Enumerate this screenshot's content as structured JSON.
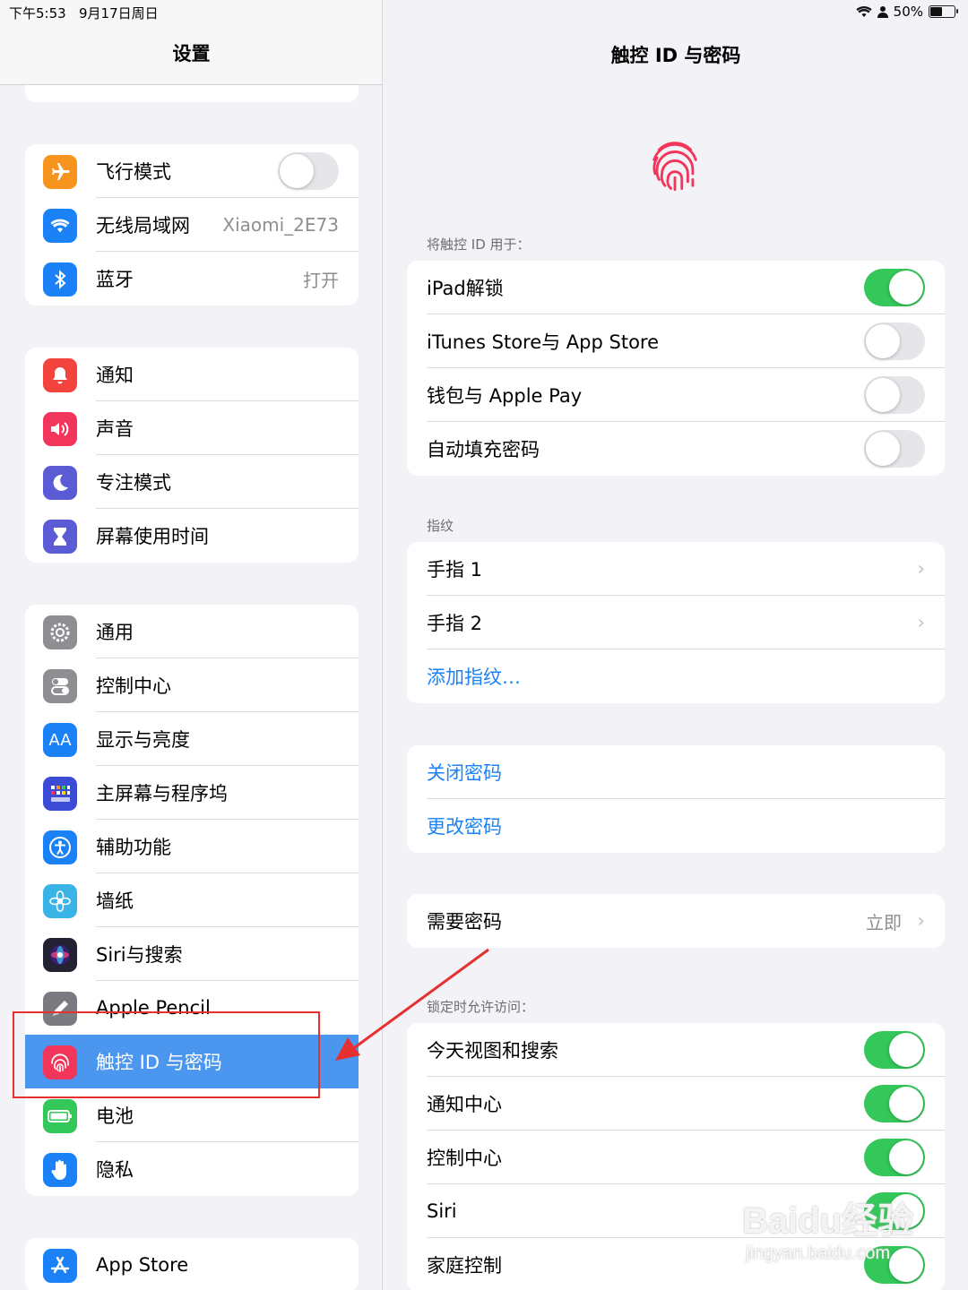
{
  "status_bar": {
    "time": "下午5:53",
    "date": "9月17日周日",
    "battery_text": "50%",
    "battery_level": 0.5
  },
  "sidebar": {
    "title": "设置",
    "groups": [
      [
        {
          "label": "飞行模式",
          "icon": "airplane-icon",
          "color": "#f7941d",
          "toggle": false
        },
        {
          "label": "无线局域网",
          "icon": "wifi-icon",
          "color": "#1a82f6",
          "value": "Xiaomi_2E73"
        },
        {
          "label": "蓝牙",
          "icon": "bluetooth-icon",
          "color": "#1a82f6",
          "value": "打开"
        }
      ],
      [
        {
          "label": "通知",
          "icon": "bell-icon",
          "color": "#f2433d"
        },
        {
          "label": "声音",
          "icon": "speaker-icon",
          "color": "#f2365b"
        },
        {
          "label": "专注模式",
          "icon": "moon-icon",
          "color": "#5b5bd6"
        },
        {
          "label": "屏幕使用时间",
          "icon": "hourglass-icon",
          "color": "#5b5bd6"
        }
      ],
      [
        {
          "label": "通用",
          "icon": "gear-icon",
          "color": "#8e8e93"
        },
        {
          "label": "控制中心",
          "icon": "switches-icon",
          "color": "#8e8e93"
        },
        {
          "label": "显示与亮度",
          "icon": "text-size-icon",
          "color": "#1a82f6"
        },
        {
          "label": "主屏幕与程序坞",
          "icon": "grid-icon",
          "color": "#3b4bd6"
        },
        {
          "label": "辅助功能",
          "icon": "accessibility-icon",
          "color": "#1a82f6"
        },
        {
          "label": "墙纸",
          "icon": "flower-icon",
          "color": "#3ab4e6"
        },
        {
          "label": "Siri与搜索",
          "icon": "siri-icon",
          "color": "#222233"
        },
        {
          "label": "Apple Pencil",
          "icon": "pencil-icon",
          "color": "#7a7a80"
        },
        {
          "label": "触控 ID 与密码",
          "icon": "fingerprint-icon",
          "color": "#f2365b",
          "selected": true
        },
        {
          "label": "电池",
          "icon": "battery-icon",
          "color": "#34c759"
        },
        {
          "label": "隐私",
          "icon": "hand-icon",
          "color": "#1a82f6"
        }
      ],
      [
        {
          "label": "App Store",
          "icon": "appstore-icon",
          "color": "#1a82f6"
        }
      ]
    ]
  },
  "detail": {
    "title": "触控 ID 与密码",
    "use_for_header": "将触控 ID 用于：",
    "use_for": [
      {
        "label": "iPad解锁",
        "toggle": true
      },
      {
        "label": "iTunes Store与 App Store",
        "toggle": false
      },
      {
        "label": "钱包与 Apple Pay",
        "toggle": false
      },
      {
        "label": "自动填充密码",
        "toggle": false
      }
    ],
    "fingerprints_header": "指纹",
    "fingerprints": [
      {
        "label": "手指 1"
      },
      {
        "label": "手指 2"
      }
    ],
    "add_fingerprint": "添加指纹…",
    "passcode_actions": [
      "关闭密码",
      "更改密码"
    ],
    "require_passcode": {
      "label": "需要密码",
      "value": "立即"
    },
    "locked_header": "锁定时允许访问：",
    "locked_access": [
      {
        "label": "今天视图和搜索",
        "toggle": true
      },
      {
        "label": "通知中心",
        "toggle": true
      },
      {
        "label": "控制中心",
        "toggle": true
      },
      {
        "label": "Siri",
        "toggle": true
      },
      {
        "label": "家庭控制",
        "toggle": true
      }
    ]
  },
  "watermark": {
    "brand": "Baidu经验",
    "url": "jingyan.baidu.com"
  }
}
